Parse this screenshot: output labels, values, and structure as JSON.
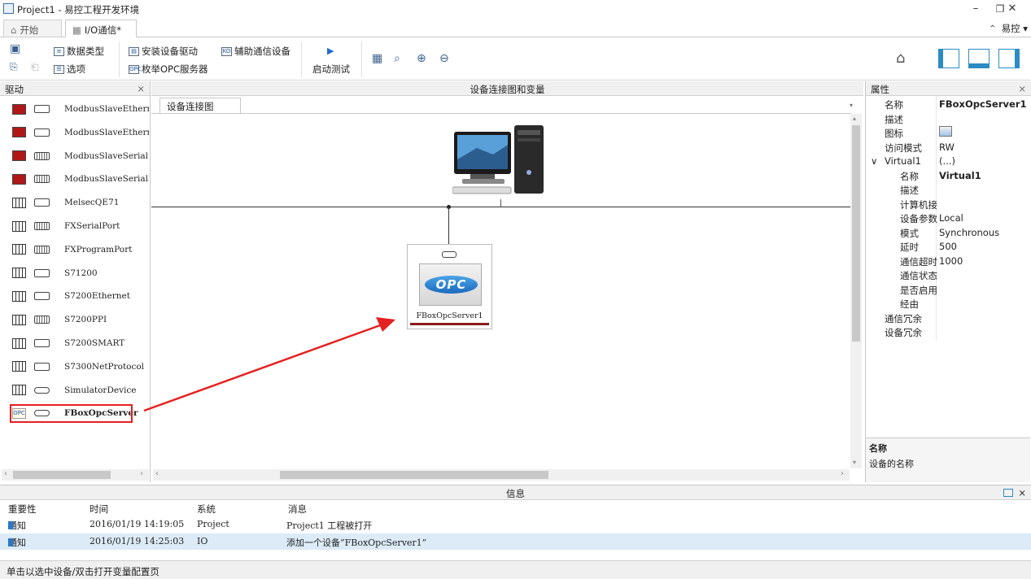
{
  "window": {
    "title": "Project1 - 易控工程开发环境",
    "min": "–",
    "restore": "❐",
    "close": "✕"
  },
  "tabs": [
    {
      "label": "开始",
      "icon": "home-icon"
    },
    {
      "label": "I/O通信*",
      "icon": "io-icon"
    }
  ],
  "user": {
    "label": "易控 ▾",
    "collapse": "⌃"
  },
  "ribbon": {
    "datatype": "数据类型",
    "options": "选项",
    "install_driver": "安装设备驱动",
    "enum_opc": "枚举OPC服务器",
    "aux_comm": "辅助通信设备",
    "start_test": "启动测试"
  },
  "left": {
    "title": "驱动",
    "close": "×",
    "items": [
      {
        "name": "ModbusSlaveEthernet",
        "dev": "red",
        "conn": "ethernet"
      },
      {
        "name": "ModbusSlaveEthernetUdp",
        "dev": "red",
        "conn": "ethernet"
      },
      {
        "name": "ModbusSlaveSerial",
        "dev": "red",
        "conn": "serial"
      },
      {
        "name": "ModbusSlaveSerialEx",
        "dev": "red",
        "conn": "serial"
      },
      {
        "name": "MelsecQE71",
        "dev": "plc",
        "conn": "ethernet"
      },
      {
        "name": "FXSerialPort",
        "dev": "plc",
        "conn": "serial"
      },
      {
        "name": "FXProgramPort",
        "dev": "plc",
        "conn": "serial"
      },
      {
        "name": "S71200",
        "dev": "plc",
        "conn": "ethernet"
      },
      {
        "name": "S7200Ethernet",
        "dev": "plc",
        "conn": "ethernet"
      },
      {
        "name": "S7200PPI",
        "dev": "plc",
        "conn": "serial"
      },
      {
        "name": "S7200SMART",
        "dev": "plc",
        "conn": "ethernet"
      },
      {
        "name": "S7300NetProtocol",
        "dev": "plc",
        "conn": "ethernet"
      },
      {
        "name": "SimulatorDevice",
        "dev": "plc",
        "conn": "virtual"
      },
      {
        "name": "FBoxOpcServer",
        "dev": "opc",
        "conn": "virtual",
        "selected": true
      }
    ]
  },
  "center": {
    "title": "设备连接图和变量",
    "subtab": "设备连接图",
    "device": {
      "name": "FBoxOpcServer1",
      "logo": "OPC"
    }
  },
  "right": {
    "title": "属性",
    "close": "×",
    "props": [
      {
        "k": "名称",
        "v": "FBoxOpcServer1",
        "indent": 0,
        "bold": true
      },
      {
        "k": "描述",
        "v": "",
        "indent": 0
      },
      {
        "k": "图标",
        "v": "",
        "indent": 0,
        "icon": true
      },
      {
        "k": "访问模式",
        "v": "RW",
        "indent": 0
      },
      {
        "k": "Virtual1",
        "v": "(...)",
        "indent": 0,
        "expander": "∨"
      },
      {
        "k": "名称",
        "v": "Virtual1",
        "indent": 1,
        "bold": true
      },
      {
        "k": "描述",
        "v": "",
        "indent": 1
      },
      {
        "k": "计算机接",
        "v": "",
        "indent": 1
      },
      {
        "k": "设备参数",
        "v": "Local",
        "indent": 1
      },
      {
        "k": "模式",
        "v": "Synchronous",
        "indent": 1
      },
      {
        "k": "延时",
        "v": "500",
        "indent": 1
      },
      {
        "k": "通信超时",
        "v": "1000",
        "indent": 1
      },
      {
        "k": "通信状态",
        "v": "",
        "indent": 1
      },
      {
        "k": "是否启用",
        "v": "",
        "indent": 1
      },
      {
        "k": "经由",
        "v": "",
        "indent": 1
      },
      {
        "k": "通信冗余",
        "v": "",
        "indent": 0
      },
      {
        "k": "设备冗余",
        "v": "",
        "indent": 0
      }
    ],
    "desc_title": "名称",
    "desc_text": "设备的名称"
  },
  "info": {
    "title": "信息",
    "cols": [
      "重要性",
      "时间",
      "系统",
      "消息"
    ],
    "rows": [
      {
        "sev": "通知",
        "time": "2016/01/19 14:19:05",
        "sys": "Project",
        "msg": "Project1 工程被打开"
      },
      {
        "sev": "通知",
        "time": "2016/01/19 14:25:03",
        "sys": "IO",
        "msg": "添加一个设备“FBoxOpcServer1”"
      }
    ]
  },
  "status": "单击以选中设备/双击打开变量配置页",
  "colors": {
    "accent": "#2b8cc4",
    "highlight": "#e52020",
    "selected_row": "#dcebf7"
  }
}
